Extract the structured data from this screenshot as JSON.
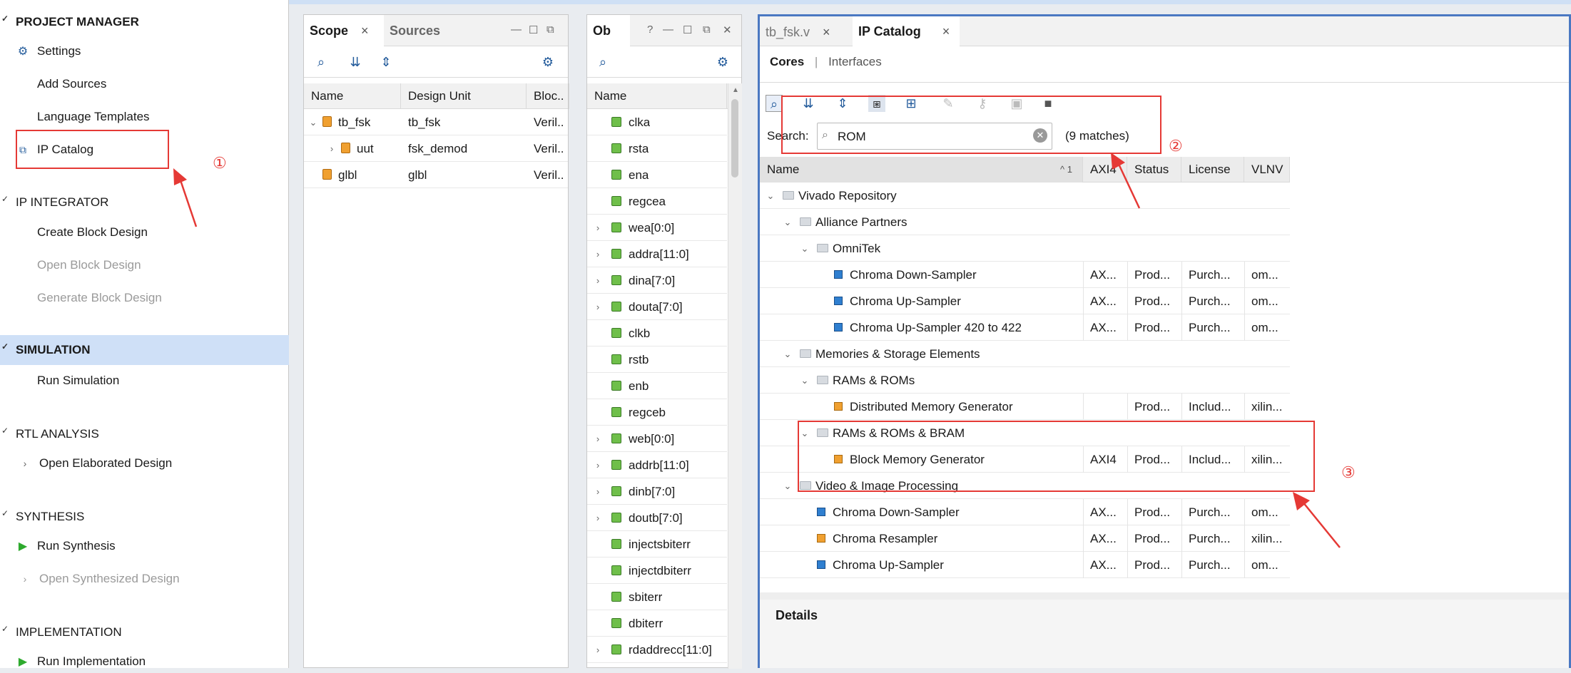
{
  "flow": {
    "project_manager": "PROJECT MANAGER",
    "settings": "Settings",
    "add_sources": "Add Sources",
    "language_templates": "Language Templates",
    "ip_catalog": "IP Catalog",
    "ip_integrator": "IP INTEGRATOR",
    "create_block_design": "Create Block Design",
    "open_block_design": "Open Block Design",
    "generate_block_design": "Generate Block Design",
    "simulation": "SIMULATION",
    "run_simulation": "Run Simulation",
    "rtl_analysis": "RTL ANALYSIS",
    "open_elaborated_design": "Open Elaborated Design",
    "synthesis": "SYNTHESIS",
    "run_synthesis": "Run Synthesis",
    "open_synthesized_design": "Open Synthesized Design",
    "implementation": "IMPLEMENTATION",
    "run_implementation": "Run Implementation"
  },
  "scope": {
    "tab_scope": "Scope",
    "tab_sources": "Sources",
    "columns": [
      "Name",
      "Design Unit",
      "Bloc.."
    ],
    "rows": [
      {
        "name": "tb_fsk",
        "unit": "tb_fsk",
        "block": "Veril.."
      },
      {
        "name": "uut",
        "unit": "fsk_demod",
        "block": "Veril.."
      },
      {
        "name": "glbl",
        "unit": "glbl",
        "block": "Veril.."
      }
    ]
  },
  "objects": {
    "tab": "Ob",
    "column": "Name",
    "items": [
      "clka",
      "rsta",
      "ena",
      "regcea",
      "wea[0:0]",
      "addra[11:0]",
      "dina[7:0]",
      "douta[7:0]",
      "clkb",
      "rstb",
      "enb",
      "regceb",
      "web[0:0]",
      "addrb[11:0]",
      "dinb[7:0]",
      "doutb[7:0]",
      "injectsbiterr",
      "injectdbiterr",
      "sbiterr",
      "dbiterr",
      "rdaddrecc[11:0]"
    ]
  },
  "catalog": {
    "tab_file": "tb_fsk.v",
    "tab_ip": "IP Catalog",
    "subtab_cores": "Cores",
    "subtab_sep": "|",
    "subtab_interfaces": "Interfaces",
    "search_label": "Search:",
    "search_value": "ROM",
    "matches": "(9 matches)",
    "columns": [
      "Name",
      "AXI4",
      "Status",
      "License",
      "VLNV"
    ],
    "sort_indicator": "^ 1",
    "rows": [
      {
        "name": "Vivado Repository",
        "axi": "",
        "status": "",
        "license": "",
        "vlnv": ""
      },
      {
        "name": "Alliance Partners",
        "axi": "",
        "status": "",
        "license": "",
        "vlnv": ""
      },
      {
        "name": "OmniTek",
        "axi": "",
        "status": "",
        "license": "",
        "vlnv": ""
      },
      {
        "name": "Chroma Down-Sampler",
        "axi": "AX...",
        "status": "Prod...",
        "license": "Purch...",
        "vlnv": "om..."
      },
      {
        "name": "Chroma Up-Sampler",
        "axi": "AX...",
        "status": "Prod...",
        "license": "Purch...",
        "vlnv": "om..."
      },
      {
        "name": "Chroma Up-Sampler 420 to 422",
        "axi": "AX...",
        "status": "Prod...",
        "license": "Purch...",
        "vlnv": "om..."
      },
      {
        "name": "Memories & Storage Elements",
        "axi": "",
        "status": "",
        "license": "",
        "vlnv": ""
      },
      {
        "name": "RAMs & ROMs",
        "axi": "",
        "status": "",
        "license": "",
        "vlnv": ""
      },
      {
        "name": "Distributed Memory Generator",
        "axi": "",
        "status": "Prod...",
        "license": "Includ...",
        "vlnv": "xilin..."
      },
      {
        "name": "RAMs & ROMs & BRAM",
        "axi": "",
        "status": "",
        "license": "",
        "vlnv": ""
      },
      {
        "name": "Block Memory Generator",
        "axi": "AXI4",
        "status": "Prod...",
        "license": "Includ...",
        "vlnv": "xilin..."
      },
      {
        "name": "Video & Image Processing",
        "axi": "",
        "status": "",
        "license": "",
        "vlnv": ""
      },
      {
        "name": "Chroma Down-Sampler",
        "axi": "AX...",
        "status": "Prod...",
        "license": "Purch...",
        "vlnv": "om..."
      },
      {
        "name": "Chroma Resampler",
        "axi": "AX...",
        "status": "Prod...",
        "license": "Purch...",
        "vlnv": "xilin..."
      },
      {
        "name": "Chroma Up-Sampler",
        "axi": "AX...",
        "status": "Prod...",
        "license": "Purch...",
        "vlnv": "om..."
      }
    ],
    "details": "Details"
  },
  "annotations": [
    "①",
    "②",
    "③"
  ]
}
